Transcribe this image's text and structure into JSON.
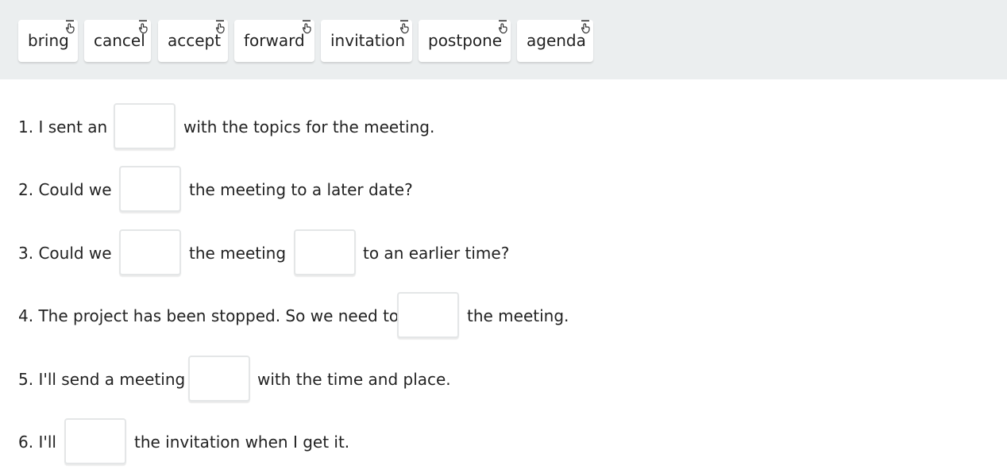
{
  "word_bank": {
    "chips": [
      {
        "label": "bring",
        "icon": "drag-handle-icon"
      },
      {
        "label": "cancel",
        "icon": "drag-handle-icon"
      },
      {
        "label": "accept",
        "icon": "drag-handle-icon"
      },
      {
        "label": "forward",
        "icon": "drag-handle-icon"
      },
      {
        "label": "invitation",
        "icon": "drag-handle-icon"
      },
      {
        "label": "postpone",
        "icon": "drag-handle-icon"
      },
      {
        "label": "agenda",
        "icon": "drag-handle-icon"
      }
    ]
  },
  "exercise": {
    "sentences": [
      {
        "parts": [
          "1. I sent an",
          "with the topics for the meeting."
        ]
      },
      {
        "parts": [
          "2. Could we",
          "the meeting to a later date?"
        ]
      },
      {
        "parts": [
          "3. Could we",
          "the meeting",
          "to an earlier time?"
        ]
      },
      {
        "parts": [
          "4. The project has been stopped. So we need to",
          "the meeting."
        ]
      },
      {
        "parts": [
          "5. I'll send a meeting",
          "with the time and place."
        ]
      },
      {
        "parts": [
          "6. I'll",
          "the invitation when I get it."
        ]
      }
    ]
  },
  "colors": {
    "word_bank_background": "#ebeeef",
    "chip_background": "#ffffff",
    "gap_border": "#e4e6e7",
    "text": "#222222"
  }
}
